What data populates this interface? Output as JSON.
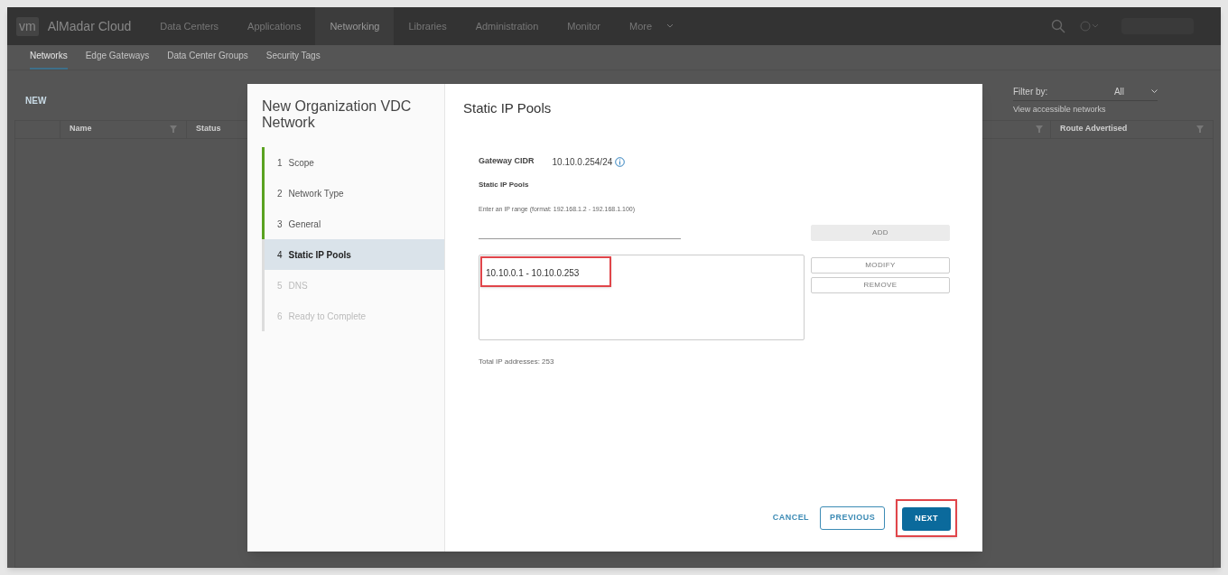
{
  "header": {
    "logo": "vm",
    "brand": "AlMadar Cloud",
    "nav": [
      {
        "label": "Data Centers",
        "selected": false
      },
      {
        "label": "Applications",
        "selected": false
      },
      {
        "label": "Networking",
        "selected": true
      },
      {
        "label": "Libraries",
        "selected": false
      },
      {
        "label": "Administration",
        "selected": false
      },
      {
        "label": "Monitor",
        "selected": false
      },
      {
        "label": "More",
        "selected": false
      }
    ]
  },
  "subnav": [
    {
      "label": "Networks",
      "selected": true
    },
    {
      "label": "Edge Gateways",
      "selected": false
    },
    {
      "label": "Data Center Groups",
      "selected": false
    },
    {
      "label": "Security Tags",
      "selected": false
    }
  ],
  "page": {
    "new_button": "NEW",
    "filter": {
      "label": "Filter by:",
      "value": "All",
      "hint": "View accessible networks"
    },
    "table": {
      "columns_left": [
        "Name",
        "Status"
      ],
      "columns_right": [
        "Route Advertised"
      ]
    }
  },
  "dialog": {
    "title": "New Organization VDC Network",
    "steps": [
      {
        "number": "1",
        "label": "Scope",
        "kind": "done",
        "selected": false
      },
      {
        "number": "2",
        "label": "Network Type",
        "kind": "done",
        "selected": false
      },
      {
        "number": "3",
        "label": "General",
        "kind": "done",
        "selected": false
      },
      {
        "number": "4",
        "label": "Static IP Pools",
        "kind": "current",
        "selected": true
      },
      {
        "number": "5",
        "label": "DNS",
        "kind": "pending",
        "selected": false
      },
      {
        "number": "6",
        "label": "Ready to Complete",
        "kind": "pending",
        "selected": false
      }
    ],
    "heading": "Static IP Pools",
    "gateway_label": "Gateway CIDR",
    "gateway_value": "10.10.0.254/24",
    "pools_label": "Static IP Pools",
    "range_hint": "Enter an IP range (format: 192.168.1.2 - 192.168.1.100)",
    "pools": [
      {
        "range": "10.10.0.1 - 10.10.0.253",
        "highlighted": true
      }
    ],
    "side_buttons": [
      {
        "label": "ADD",
        "disabled": true,
        "kind": "filled"
      },
      {
        "label": "MODIFY",
        "disabled": true,
        "kind": "outline"
      },
      {
        "label": "REMOVE",
        "disabled": true,
        "kind": "outline"
      }
    ],
    "total": "Total IP addresses: 253",
    "footer": {
      "cancel": "CANCEL",
      "previous": "PREVIOUS",
      "next": "NEXT",
      "next_highlighted": true
    }
  }
}
